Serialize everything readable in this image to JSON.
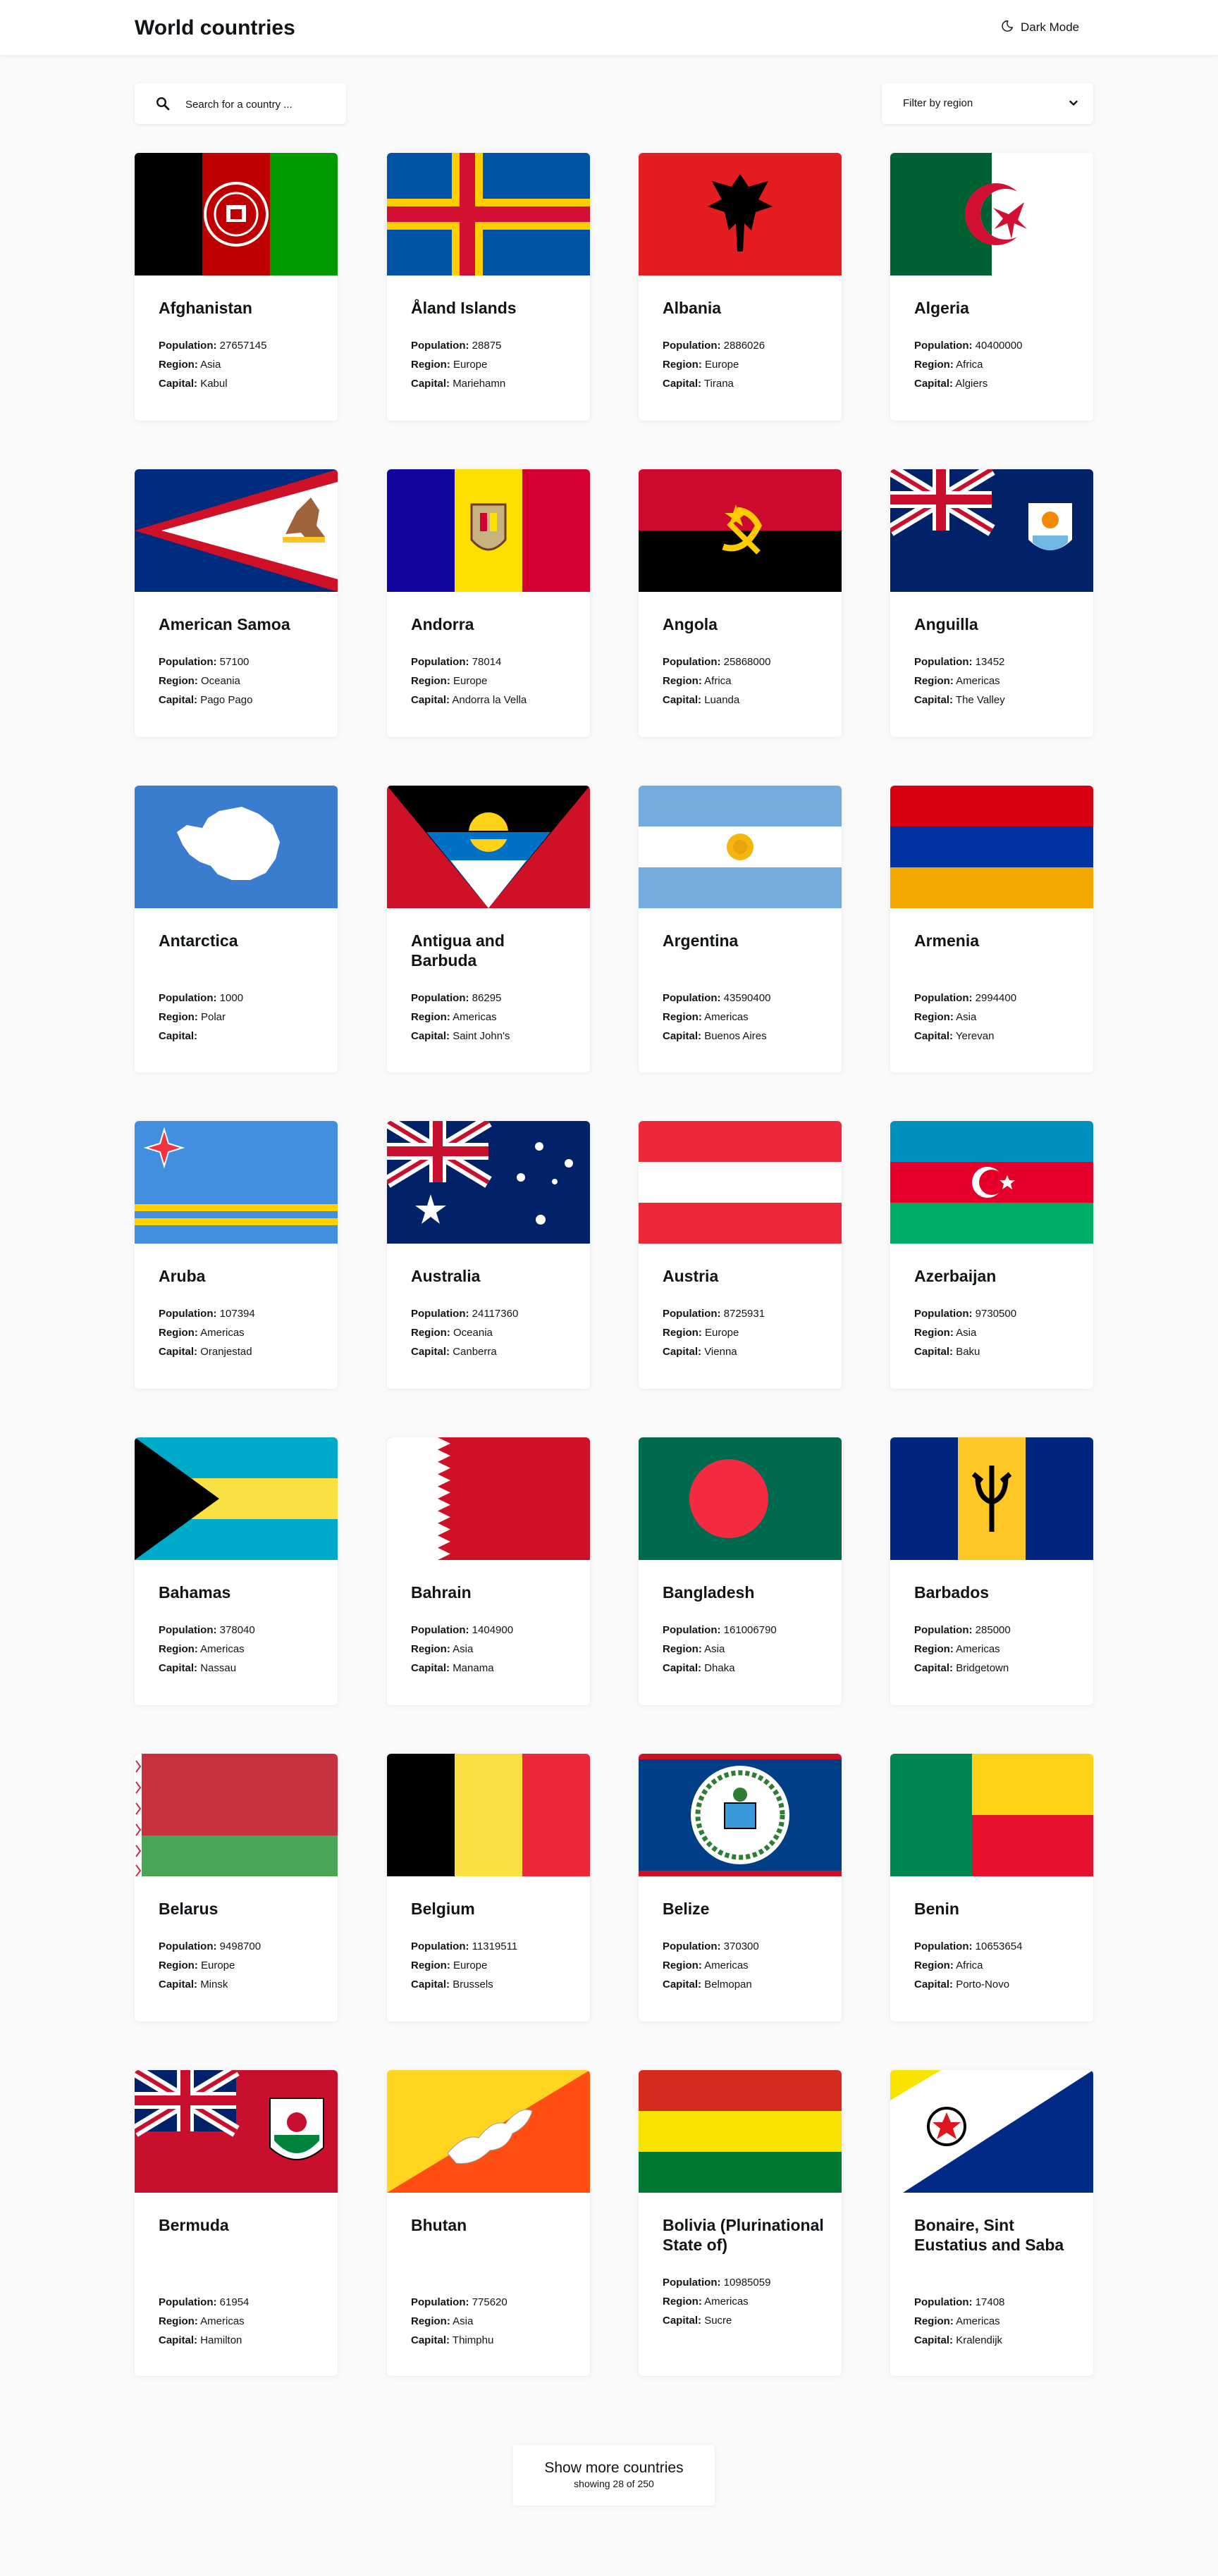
{
  "header": {
    "title": "World countries",
    "theme_toggle_label": "Dark Mode"
  },
  "search": {
    "placeholder": "Search for a country ..."
  },
  "filter": {
    "label": "Filter by region"
  },
  "labels": {
    "population": "Population:",
    "region": "Region:",
    "capital": "Capital:"
  },
  "countries": [
    {
      "name": "Afghanistan",
      "population": "27657145",
      "region": "Asia",
      "capital": "Kabul",
      "flag": "afghanistan-flag"
    },
    {
      "name": "Åland Islands",
      "population": "28875",
      "region": "Europe",
      "capital": "Mariehamn",
      "flag": "aland-flag"
    },
    {
      "name": "Albania",
      "population": "2886026",
      "region": "Europe",
      "capital": "Tirana",
      "flag": "albania-flag"
    },
    {
      "name": "Algeria",
      "population": "40400000",
      "region": "Africa",
      "capital": "Algiers",
      "flag": "algeria-flag"
    },
    {
      "name": "American Samoa",
      "population": "57100",
      "region": "Oceania",
      "capital": "Pago Pago",
      "flag": "american-samoa-flag"
    },
    {
      "name": "Andorra",
      "population": "78014",
      "region": "Europe",
      "capital": "Andorra la Vella",
      "flag": "andorra-flag"
    },
    {
      "name": "Angola",
      "population": "25868000",
      "region": "Africa",
      "capital": "Luanda",
      "flag": "angola-flag"
    },
    {
      "name": "Anguilla",
      "population": "13452",
      "region": "Americas",
      "capital": "The Valley",
      "flag": "anguilla-flag"
    },
    {
      "name": "Antarctica",
      "population": "1000",
      "region": "Polar",
      "capital": "",
      "flag": "antarctica-flag"
    },
    {
      "name": "Antigua and Barbuda",
      "population": "86295",
      "region": "Americas",
      "capital": "Saint John's",
      "flag": "antigua-flag"
    },
    {
      "name": "Argentina",
      "population": "43590400",
      "region": "Americas",
      "capital": "Buenos Aires",
      "flag": "argentina-flag"
    },
    {
      "name": "Armenia",
      "population": "2994400",
      "region": "Asia",
      "capital": "Yerevan",
      "flag": "armenia-flag"
    },
    {
      "name": "Aruba",
      "population": "107394",
      "region": "Americas",
      "capital": "Oranjestad",
      "flag": "aruba-flag"
    },
    {
      "name": "Australia",
      "population": "24117360",
      "region": "Oceania",
      "capital": "Canberra",
      "flag": "australia-flag"
    },
    {
      "name": "Austria",
      "population": "8725931",
      "region": "Europe",
      "capital": "Vienna",
      "flag": "austria-flag"
    },
    {
      "name": "Azerbaijan",
      "population": "9730500",
      "region": "Asia",
      "capital": "Baku",
      "flag": "azerbaijan-flag"
    },
    {
      "name": "Bahamas",
      "population": "378040",
      "region": "Americas",
      "capital": "Nassau",
      "flag": "bahamas-flag"
    },
    {
      "name": "Bahrain",
      "population": "1404900",
      "region": "Asia",
      "capital": "Manama",
      "flag": "bahrain-flag"
    },
    {
      "name": "Bangladesh",
      "population": "161006790",
      "region": "Asia",
      "capital": "Dhaka",
      "flag": "bangladesh-flag"
    },
    {
      "name": "Barbados",
      "population": "285000",
      "region": "Americas",
      "capital": "Bridgetown",
      "flag": "barbados-flag"
    },
    {
      "name": "Belarus",
      "population": "9498700",
      "region": "Europe",
      "capital": "Minsk",
      "flag": "belarus-flag"
    },
    {
      "name": "Belgium",
      "population": "11319511",
      "region": "Europe",
      "capital": "Brussels",
      "flag": "belgium-flag"
    },
    {
      "name": "Belize",
      "population": "370300",
      "region": "Americas",
      "capital": "Belmopan",
      "flag": "belize-flag"
    },
    {
      "name": "Benin",
      "population": "10653654",
      "region": "Africa",
      "capital": "Porto-Novo",
      "flag": "benin-flag"
    },
    {
      "name": "Bermuda",
      "population": "61954",
      "region": "Americas",
      "capital": "Hamilton",
      "flag": "bermuda-flag"
    },
    {
      "name": "Bhutan",
      "population": "775620",
      "region": "Asia",
      "capital": "Thimphu",
      "flag": "bhutan-flag"
    },
    {
      "name": "Bolivia (Plurinational State of)",
      "population": "10985059",
      "region": "Americas",
      "capital": "Sucre",
      "flag": "bolivia-flag"
    },
    {
      "name": "Bonaire, Sint Eustatius and Saba",
      "population": "17408",
      "region": "Americas",
      "capital": "Kralendijk",
      "flag": "bonaire-flag"
    }
  ],
  "show_more": {
    "label": "Show more countries",
    "count_text": "showing 28 of 250"
  }
}
